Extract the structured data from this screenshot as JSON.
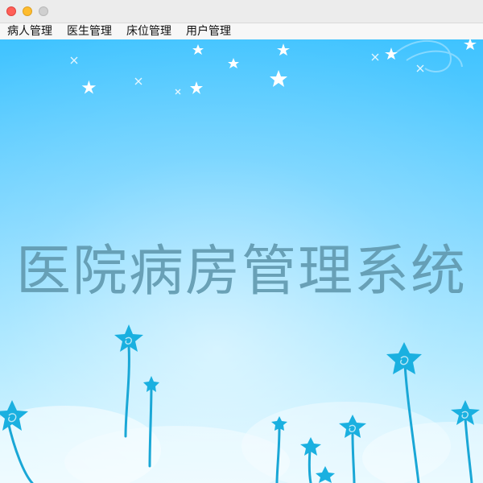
{
  "window": {
    "controls": [
      "close-icon",
      "minimize-icon",
      "zoom-icon"
    ]
  },
  "menu": {
    "items": [
      {
        "label": "病人管理"
      },
      {
        "label": "医生管理"
      },
      {
        "label": "床位管理"
      },
      {
        "label": "用户管理"
      }
    ]
  },
  "main": {
    "title": "医院病房管理系统",
    "background": {
      "sky_top": "#3fc3ff",
      "sky_bottom": "#c9f0ff",
      "flower_color": "#18a8d8"
    }
  }
}
